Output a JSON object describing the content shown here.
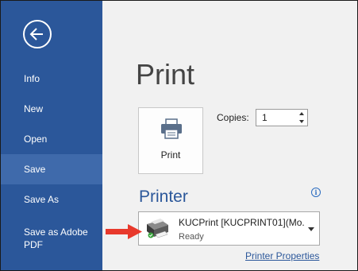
{
  "sidebar": {
    "back_icon": "back-arrow-icon",
    "items": [
      {
        "label": "Info",
        "selected": false
      },
      {
        "label": "New",
        "selected": false
      },
      {
        "label": "Open",
        "selected": false
      },
      {
        "label": "Save",
        "selected": true
      },
      {
        "label": "Save As",
        "selected": false
      },
      {
        "label": "Save as Adobe PDF",
        "selected": false
      }
    ]
  },
  "main": {
    "title": "Print",
    "print_button_label": "Print",
    "copies_label": "Copies:",
    "copies_value": "1",
    "printer_heading": "Printer",
    "info_icon_glyph": "i",
    "printer": {
      "name": "KUCPrint [KUCPRINT01](Mo...",
      "status": "Ready",
      "icon": "printer-icon"
    },
    "printer_properties_label": "Printer Properties"
  },
  "colors": {
    "sidebar": "#2b579a",
    "sidebar_selected": "#3f6aab",
    "accent": "#2b579a",
    "annotation_arrow": "#e8392c"
  }
}
